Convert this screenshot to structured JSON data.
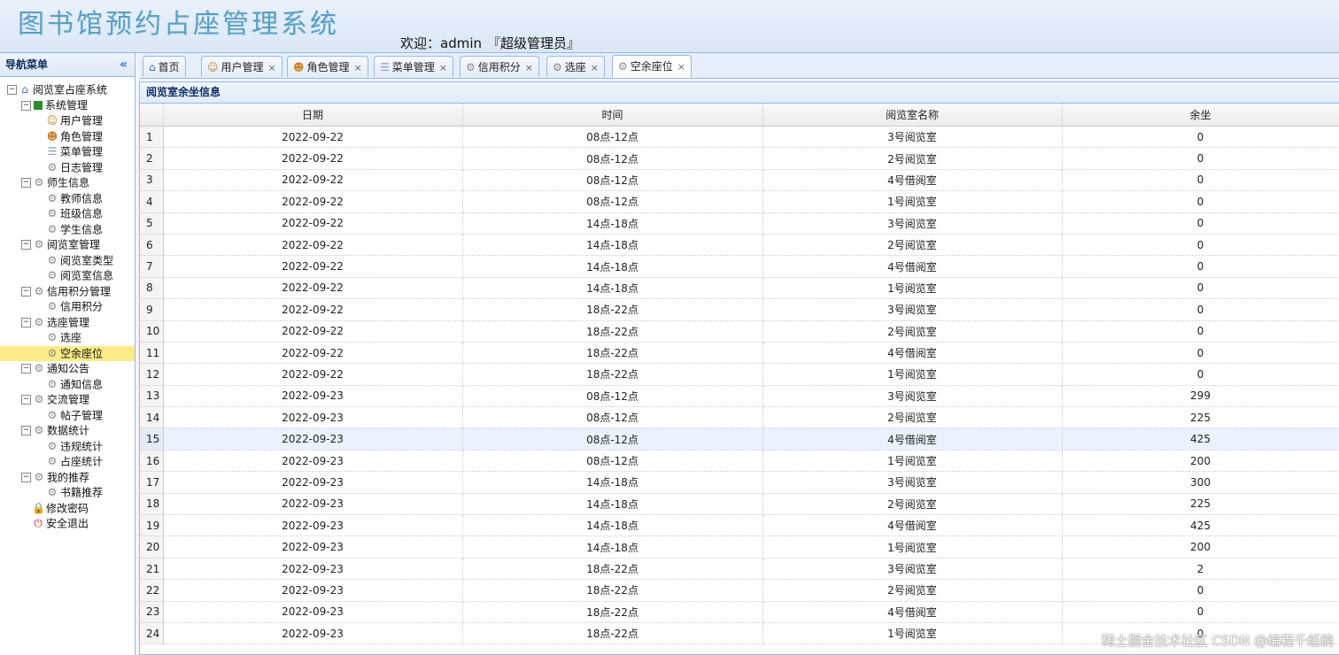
{
  "header": {
    "title": "图书馆预约占座管理系统",
    "welcome": "欢迎：admin",
    "role": "『超级管理员』"
  },
  "sidebar": {
    "title": "导航菜单",
    "collapse_icon": "«",
    "tree": [
      {
        "label": "阅览室占座系统",
        "level": 0,
        "icon": "home-icon",
        "toggle": "−"
      },
      {
        "label": "系统管理",
        "level": 1,
        "icon": "system-icon",
        "toggle": "−"
      },
      {
        "label": "用户管理",
        "level": 2,
        "icon": "user-icon"
      },
      {
        "label": "角色管理",
        "level": 2,
        "icon": "users-icon"
      },
      {
        "label": "菜单管理",
        "level": 2,
        "icon": "menu-icon"
      },
      {
        "label": "日志管理",
        "level": 2,
        "icon": "gear-icon"
      },
      {
        "label": "师生信息",
        "level": 1,
        "icon": "gear-icon",
        "toggle": "−"
      },
      {
        "label": "教师信息",
        "level": 2,
        "icon": "gear-icon"
      },
      {
        "label": "班级信息",
        "level": 2,
        "icon": "gear-icon"
      },
      {
        "label": "学生信息",
        "level": 2,
        "icon": "gear-icon"
      },
      {
        "label": "阅览室管理",
        "level": 1,
        "icon": "gear-icon",
        "toggle": "−"
      },
      {
        "label": "阅览室类型",
        "level": 2,
        "icon": "gear-icon"
      },
      {
        "label": "阅览室信息",
        "level": 2,
        "icon": "gear-icon"
      },
      {
        "label": "信用积分管理",
        "level": 1,
        "icon": "gear-icon",
        "toggle": "−"
      },
      {
        "label": "信用积分",
        "level": 2,
        "icon": "gear-icon"
      },
      {
        "label": "选座管理",
        "level": 1,
        "icon": "gear-icon",
        "toggle": "−"
      },
      {
        "label": "选座",
        "level": 2,
        "icon": "gear-icon"
      },
      {
        "label": "空余座位",
        "level": 2,
        "icon": "gear-icon",
        "selected": true
      },
      {
        "label": "通知公告",
        "level": 1,
        "icon": "gear-icon",
        "toggle": "−"
      },
      {
        "label": "通知信息",
        "level": 2,
        "icon": "gear-icon"
      },
      {
        "label": "交流管理",
        "level": 1,
        "icon": "gear-icon",
        "toggle": "−"
      },
      {
        "label": "帖子管理",
        "level": 2,
        "icon": "gear-icon"
      },
      {
        "label": "数据统计",
        "level": 1,
        "icon": "gear-icon",
        "toggle": "−"
      },
      {
        "label": "违规统计",
        "level": 2,
        "icon": "gear-icon"
      },
      {
        "label": "占座统计",
        "level": 2,
        "icon": "gear-icon"
      },
      {
        "label": "我的推荐",
        "level": 1,
        "icon": "gear-icon",
        "toggle": "−"
      },
      {
        "label": "书籍推荐",
        "level": 2,
        "icon": "gear-icon"
      },
      {
        "label": "修改密码",
        "level": "1leaf",
        "icon": "lock-icon"
      },
      {
        "label": "安全退出",
        "level": "1leaf",
        "icon": "exit-icon"
      }
    ]
  },
  "tabs": [
    {
      "label": "首页",
      "icon": "home-icon",
      "closable": false
    },
    {
      "label": "用户管理",
      "icon": "user-icon",
      "closable": true
    },
    {
      "label": "角色管理",
      "icon": "users-icon",
      "closable": true
    },
    {
      "label": "菜单管理",
      "icon": "menu-icon",
      "closable": true
    },
    {
      "label": "信用积分",
      "icon": "gear-icon",
      "closable": true
    },
    {
      "label": "选座",
      "icon": "gear-icon",
      "closable": true
    },
    {
      "label": "空余座位",
      "icon": "gear-icon",
      "closable": true,
      "active": true
    }
  ],
  "panel": {
    "title": "阅览室余坐信息",
    "columns": [
      "日期",
      "时间",
      "阅览室名称",
      "余坐"
    ],
    "highlight_row": 15,
    "rows": [
      [
        "1",
        "2022-09-22",
        "08点-12点",
        "3号阅览室",
        "0"
      ],
      [
        "2",
        "2022-09-22",
        "08点-12点",
        "2号阅览室",
        "0"
      ],
      [
        "3",
        "2022-09-22",
        "08点-12点",
        "4号借阅室",
        "0"
      ],
      [
        "4",
        "2022-09-22",
        "08点-12点",
        "1号阅览室",
        "0"
      ],
      [
        "5",
        "2022-09-22",
        "14点-18点",
        "3号阅览室",
        "0"
      ],
      [
        "6",
        "2022-09-22",
        "14点-18点",
        "2号阅览室",
        "0"
      ],
      [
        "7",
        "2022-09-22",
        "14点-18点",
        "4号借阅室",
        "0"
      ],
      [
        "8",
        "2022-09-22",
        "14点-18点",
        "1号阅览室",
        "0"
      ],
      [
        "9",
        "2022-09-22",
        "18点-22点",
        "3号阅览室",
        "0"
      ],
      [
        "10",
        "2022-09-22",
        "18点-22点",
        "2号阅览室",
        "0"
      ],
      [
        "11",
        "2022-09-22",
        "18点-22点",
        "4号借阅室",
        "0"
      ],
      [
        "12",
        "2022-09-22",
        "18点-22点",
        "1号阅览室",
        "0"
      ],
      [
        "13",
        "2022-09-23",
        "08点-12点",
        "3号阅览室",
        "299"
      ],
      [
        "14",
        "2022-09-23",
        "08点-12点",
        "2号阅览室",
        "225"
      ],
      [
        "15",
        "2022-09-23",
        "08点-12点",
        "4号借阅室",
        "425"
      ],
      [
        "16",
        "2022-09-23",
        "08点-12点",
        "1号阅览室",
        "200"
      ],
      [
        "17",
        "2022-09-23",
        "14点-18点",
        "3号阅览室",
        "300"
      ],
      [
        "18",
        "2022-09-23",
        "14点-18点",
        "2号阅览室",
        "225"
      ],
      [
        "19",
        "2022-09-23",
        "14点-18点",
        "4号借阅室",
        "425"
      ],
      [
        "20",
        "2022-09-23",
        "14点-18点",
        "1号阅览室",
        "200"
      ],
      [
        "21",
        "2022-09-23",
        "18点-22点",
        "3号阅览室",
        "2"
      ],
      [
        "22",
        "2022-09-23",
        "18点-22点",
        "2号阅览室",
        "0"
      ],
      [
        "23",
        "2022-09-23",
        "18点-22点",
        "4号借阅室",
        "0"
      ],
      [
        "24",
        "2022-09-23",
        "18点-22点",
        "1号阅览室",
        "0"
      ]
    ]
  },
  "watermark": "稀土掘金技术社区 CSDN @编程千纸鹤"
}
